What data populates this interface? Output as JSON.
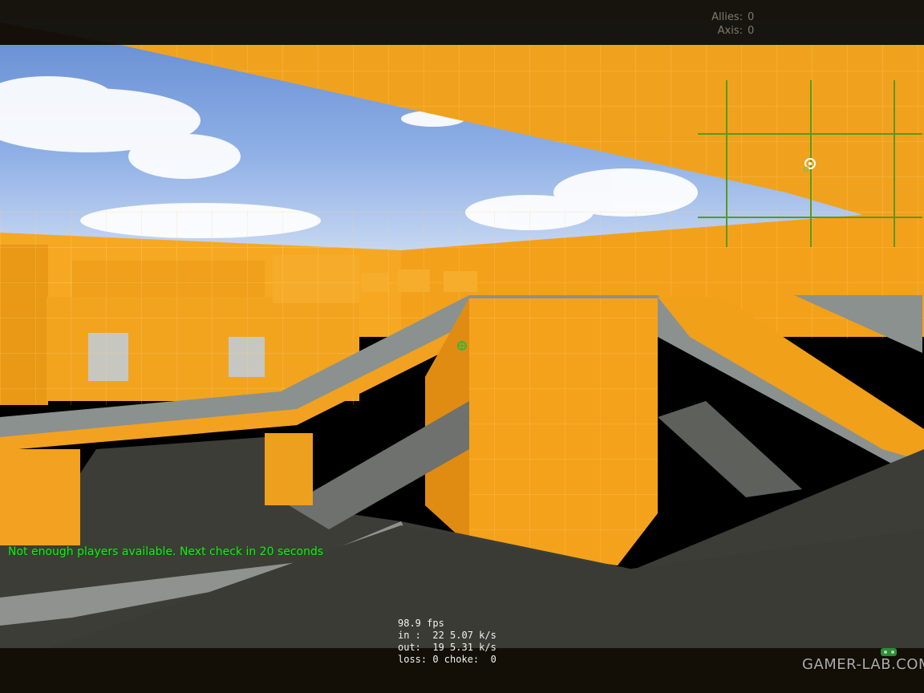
{
  "scoreboard": {
    "allies_label": "Allies:",
    "allies_score": "0",
    "axis_label": "Axis:",
    "axis_score": "0"
  },
  "server_message": "Not enough players available. Next check in 20 seconds",
  "netgraph": {
    "fps": "98.9 fps",
    "in": "in :  22 5.07 k/s",
    "out": "out:  19 5.31 k/s",
    "loss": "loss: 0 choke:  0"
  },
  "watermark": "GAMER-LAB.COM",
  "colors": {
    "wall_orange": "#f4a21c",
    "walkway_gray": "#8e9490",
    "floor_dark": "#3c3d36",
    "message_green": "#22e51f",
    "radar_green": "#5a9a1a"
  },
  "icons": {
    "crosshair": "crosshair-icon",
    "radar_player": "radar-player-icon",
    "logo": "gamer-lab-logo-icon"
  }
}
